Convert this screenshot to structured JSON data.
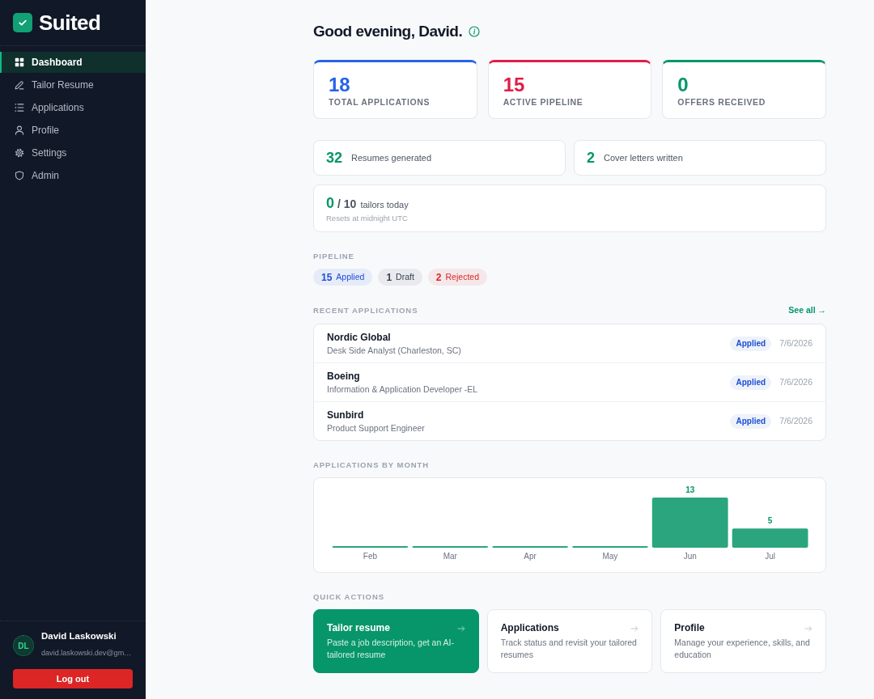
{
  "sidebar": {
    "brand": "Suited",
    "nav": [
      {
        "label": "Dashboard",
        "selected": true
      },
      {
        "label": "Tailor Resume",
        "selected": false
      },
      {
        "label": "Applications",
        "selected": false
      },
      {
        "label": "Profile",
        "selected": false
      },
      {
        "label": "Settings",
        "selected": false
      },
      {
        "label": "Admin",
        "selected": false
      }
    ],
    "user": {
      "initials": "DL",
      "name": "David Laskowski",
      "email": "david.laskowski.dev@gm…"
    },
    "logout": "Log out"
  },
  "greeting": "Good evening, David.",
  "stats": [
    {
      "value": "18",
      "label": "TOTAL APPLICATIONS",
      "color": "#2563eb"
    },
    {
      "value": "15",
      "label": "ACTIVE PIPELINE",
      "color": "#e11d48"
    },
    {
      "value": "0",
      "label": "OFFERS RECEIVED",
      "color": "#059669"
    }
  ],
  "counters": [
    {
      "value": "32",
      "label": "Resumes generated"
    },
    {
      "value": "2",
      "label": "Cover letters written"
    }
  ],
  "usage": {
    "used": "0",
    "limit": "/ 10",
    "label": "tailors today",
    "note": "Resets at midnight UTC"
  },
  "pipeline": {
    "title": "PIPELINE",
    "chips": [
      {
        "count": "15",
        "label": "Applied",
        "color": "#1d4ed8"
      },
      {
        "count": "1",
        "label": "Draft",
        "color": "#374151"
      },
      {
        "count": "2",
        "label": "Rejected",
        "color": "#dc2626"
      }
    ]
  },
  "recent_applications": {
    "title": "RECENT APPLICATIONS",
    "link": "See all →",
    "rows": [
      {
        "company": "Nordic Global",
        "role": "Desk Side Analyst (Charleston, SC)",
        "status": "Applied",
        "date": "7/6/2026"
      },
      {
        "company": "Boeing",
        "role": "Information & Application Developer -EL",
        "status": "Applied",
        "date": "7/6/2026"
      },
      {
        "company": "Sunbird",
        "role": "Product Support Engineer",
        "status": "Applied",
        "date": "7/6/2026"
      }
    ]
  },
  "applications_by_month": {
    "title": "APPLICATIONS BY MONTH",
    "chart_data": {
      "type": "bar",
      "categories": [
        "Feb",
        "Mar",
        "Apr",
        "May",
        "Jun",
        "Jul"
      ],
      "values": [
        0,
        0,
        0,
        0,
        13,
        5
      ],
      "value_labels": [
        null,
        null,
        null,
        null,
        "13",
        "5"
      ]
    }
  },
  "quick_actions": {
    "title": "QUICK ACTIONS",
    "cards": [
      {
        "title": "Tailor resume",
        "description": "Paste a job description, get an AI-tailored resume",
        "kind": "primary"
      },
      {
        "title": "Applications",
        "description": "Track status and revisit your tailored resumes",
        "kind": "default"
      },
      {
        "title": "Profile",
        "description": "Manage your experience, skills, and education",
        "kind": "default"
      }
    ]
  }
}
